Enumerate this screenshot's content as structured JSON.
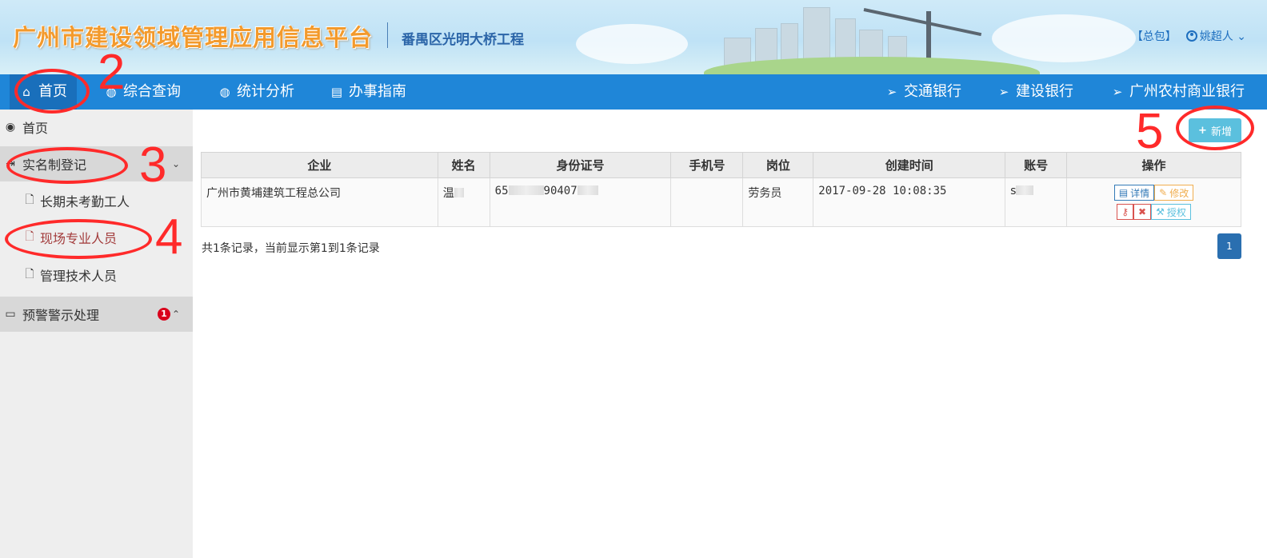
{
  "header": {
    "app_title": "广州市建设领域管理应用信息平台",
    "project_name": "番禺区光明大桥工程",
    "role": "【总包】",
    "user_name": "姚超人",
    "user_caret": "⌄"
  },
  "nav": {
    "left": [
      {
        "label": "首页",
        "icon": "home-icon"
      },
      {
        "label": "综合查询",
        "icon": "globe-icon"
      },
      {
        "label": "统计分析",
        "icon": "globe-icon"
      },
      {
        "label": "办事指南",
        "icon": "book-icon"
      }
    ],
    "right": [
      {
        "label": "交通银行",
        "icon": "paper-plane-icon"
      },
      {
        "label": "建设银行",
        "icon": "paper-plane-icon"
      },
      {
        "label": "广州农村商业银行",
        "icon": "paper-plane-icon"
      }
    ]
  },
  "sidebar": {
    "home": "首页",
    "group1": "实名制登记",
    "sub1": "长期未考勤工人",
    "sub2": "现场专业人员",
    "sub3": "管理技术人员",
    "group2": "预警警示处理",
    "group2_badge": "1"
  },
  "toolbar": {
    "add_label": "新增"
  },
  "table": {
    "headers": [
      "企业",
      "姓名",
      "身份证号",
      "手机号",
      "岗位",
      "创建时间",
      "账号",
      "操作"
    ],
    "rows": [
      {
        "company": "广州市黄埔建筑工程总公司",
        "name": "温",
        "id_prefix": "65",
        "id_middle": "90407",
        "phone": "",
        "position": "劳务员",
        "created": "2017-09-28 10:08:35",
        "account": "s",
        "op_detail": "详情",
        "op_edit": "修改",
        "op_auth": "授权"
      }
    ]
  },
  "pagination": {
    "summary": "共1条记录，当前显示第1到1条记录",
    "page": "1"
  },
  "annotations": [
    "2",
    "3",
    "4",
    "5"
  ],
  "colors": {
    "nav_bg": "#1f86d8",
    "nav_active": "#196fbb",
    "add_button": "#5bc0de",
    "annotation_red": "#ff2a2a",
    "title_orange": "#f39a2c"
  }
}
